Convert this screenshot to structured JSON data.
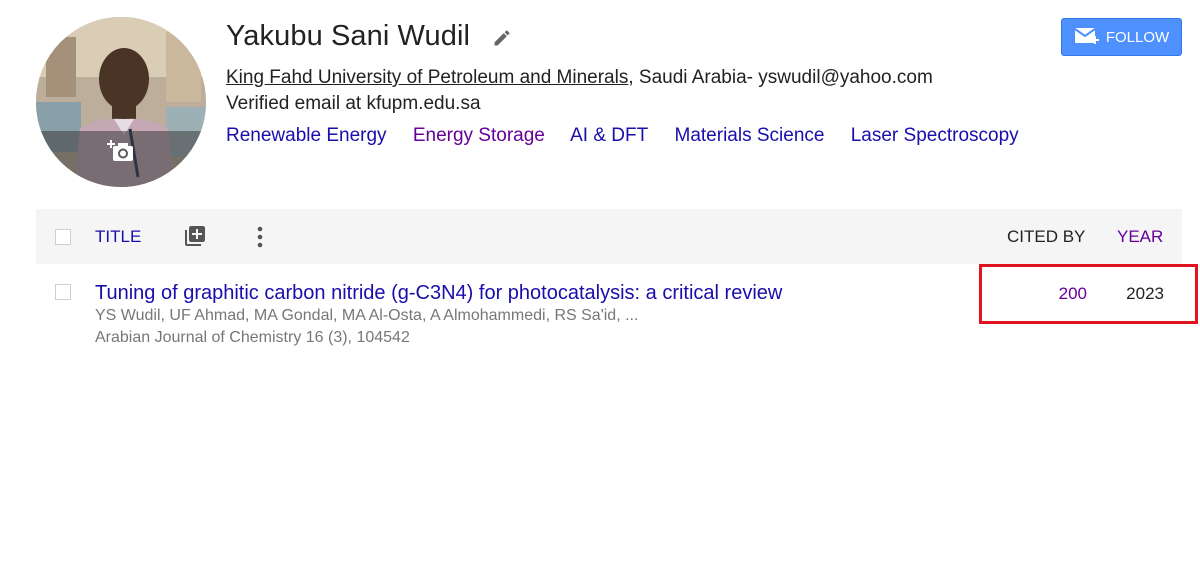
{
  "profile": {
    "name": "Yakubu Sani Wudil",
    "affiliation_link": "King Fahd University of Petroleum and Minerals",
    "affiliation_rest": ", Saudi Arabia- yswudil@yahoo.com",
    "verified_email": "Verified email at kfupm.edu.sa",
    "interests": [
      {
        "label": "Renewable Energy",
        "color": "#1a0dab"
      },
      {
        "label": "Energy Storage",
        "color": "#660099"
      },
      {
        "label": "AI & DFT",
        "color": "#1a0dab"
      },
      {
        "label": "Materials Science",
        "color": "#1a0dab"
      },
      {
        "label": "Laser Spectroscopy",
        "color": "#1a0dab"
      }
    ],
    "avatar_icon": "camera-add-icon"
  },
  "follow": {
    "label": "FOLLOW",
    "icon": "mail-plus-icon",
    "color": "#4d90fe"
  },
  "table": {
    "header": {
      "title": "TITLE",
      "cited_by": "CITED BY",
      "year": "YEAR",
      "add_icon": "add-to-library-icon",
      "more_icon": "more-vert-icon"
    },
    "rows": [
      {
        "title": "Tuning of graphitic carbon nitride (g-C3N4) for photocatalysis: a critical review",
        "authors": "YS Wudil, UF Ahmad, MA Gondal, MA Al-Osta, A Almohammedi, RS Sa'id, ...",
        "venue": "Arabian Journal of Chemistry 16 (3), 104542",
        "cited_by": "200",
        "year": "2023"
      }
    ]
  },
  "highlight_color": "#e0141e"
}
